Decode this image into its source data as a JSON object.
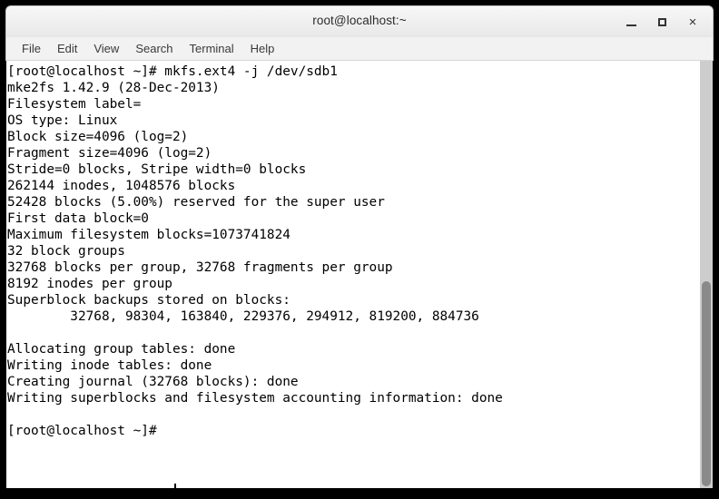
{
  "window": {
    "title": "root@localhost:~",
    "controls": {
      "minimize_label": "_",
      "maximize_label": "□",
      "close_label": "×"
    }
  },
  "menubar": {
    "items": [
      {
        "label": "File"
      },
      {
        "label": "Edit"
      },
      {
        "label": "View"
      },
      {
        "label": "Search"
      },
      {
        "label": "Terminal"
      },
      {
        "label": "Help"
      }
    ]
  },
  "terminal": {
    "prompt": "[root@localhost ~]#",
    "command": "mkfs.ext4 -j /dev/sdb1",
    "output_lines": [
      "[root@localhost ~]# mkfs.ext4 -j /dev/sdb1",
      "mke2fs 1.42.9 (28-Dec-2013)",
      "Filesystem label=",
      "OS type: Linux",
      "Block size=4096 (log=2)",
      "Fragment size=4096 (log=2)",
      "Stride=0 blocks, Stripe width=0 blocks",
      "262144 inodes, 1048576 blocks",
      "52428 blocks (5.00%) reserved for the super user",
      "First data block=0",
      "Maximum filesystem blocks=1073741824",
      "32 block groups",
      "32768 blocks per group, 32768 fragments per group",
      "8192 inodes per group",
      "Superblock backups stored on blocks:",
      "        32768, 98304, 163840, 229376, 294912, 819200, 884736",
      "",
      "Allocating group tables: done",
      "Writing inode tables: done",
      "Creating journal (32768 blocks): done",
      "Writing superblocks and filesystem accounting information: done",
      "",
      "[root@localhost ~]# "
    ],
    "text": "[root@localhost ~]# mkfs.ext4 -j /dev/sdb1\nmke2fs 1.42.9 (28-Dec-2013)\nFilesystem label=\nOS type: Linux\nBlock size=4096 (log=2)\nFragment size=4096 (log=2)\nStride=0 blocks, Stripe width=0 blocks\n262144 inodes, 1048576 blocks\n52428 blocks (5.00%) reserved for the super user\nFirst data block=0\nMaximum filesystem blocks=1073741824\n32 block groups\n32768 blocks per group, 32768 fragments per group\n8192 inodes per group\nSuperblock backups stored on blocks:\n        32768, 98304, 163840, 229376, 294912, 819200, 884736\n\nAllocating group tables: done\nWriting inode tables: done\nCreating journal (32768 blocks): done\nWriting superblocks and filesystem accounting information: done\n\n[root@localhost ~]# "
  },
  "colors": {
    "terminal_background": "#ffffff",
    "terminal_foreground": "#000000",
    "window_border": "#000000",
    "titlebar": "#f0f0f0",
    "scrollbar_track": "#cdcdcd",
    "scrollbar_thumb": "#8a8a8a"
  }
}
